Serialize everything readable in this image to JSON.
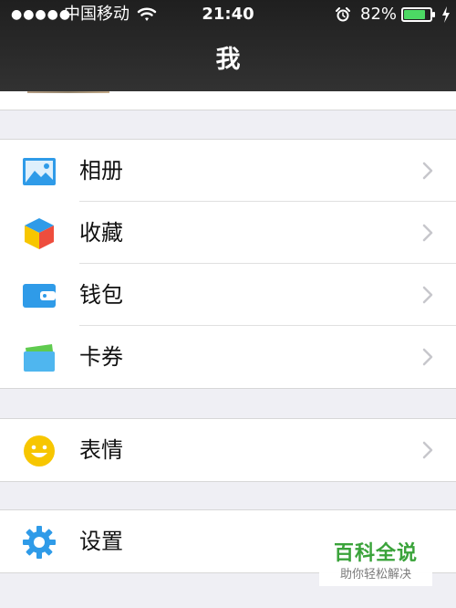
{
  "status_bar": {
    "signal": "●●●●●",
    "carrier": "中国移动",
    "time": "21:40",
    "battery_percent": "82%",
    "battery_level": 0.82,
    "icons": [
      "wifi-icon",
      "alarm-icon",
      "battery-icon",
      "charging-bolt-icon"
    ]
  },
  "nav": {
    "title": "我"
  },
  "groups": [
    {
      "items": [
        {
          "label": "相册",
          "icon": "photo-album-icon"
        },
        {
          "label": "收藏",
          "icon": "favorites-cube-icon"
        },
        {
          "label": "钱包",
          "icon": "wallet-icon"
        },
        {
          "label": "卡券",
          "icon": "card-coupon-icon"
        }
      ]
    },
    {
      "items": [
        {
          "label": "表情",
          "icon": "smiley-icon"
        }
      ]
    },
    {
      "items": [
        {
          "label": "设置",
          "icon": "settings-gear-icon"
        }
      ]
    }
  ],
  "watermark": {
    "title": "百科全说",
    "subtitle": "助你轻松解决"
  },
  "colors": {
    "nav_bg": "#2a2a2a",
    "page_bg": "#efeff4",
    "accent_blue": "#2f9be8",
    "smiley_yellow": "#f7c600",
    "battery_green": "#4cd964",
    "watermark_green": "#3aa33a"
  }
}
